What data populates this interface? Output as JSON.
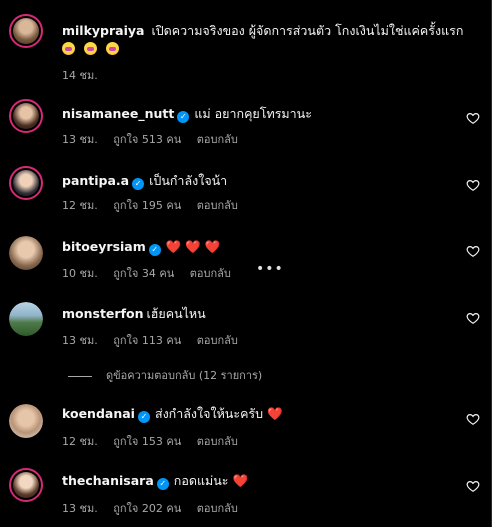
{
  "colors": {
    "background": "#000000",
    "text": "#f5f5f5",
    "meta": "#a8a8a8",
    "verified": "#0095f6",
    "heart_emoji": "#ff3040",
    "story_ring": "#d62976"
  },
  "post": {
    "username": "milkypraiya",
    "text": "เปิดความจริงของ ผู้จัดการส่วนตัว โกงเงินไม่ใช่แค่ครั้งแรก",
    "emojis": [
      "crying-face-emoji",
      "crying-face-emoji",
      "crying-face-emoji"
    ],
    "time": "14 ชม."
  },
  "comments": [
    {
      "username": "nisamanee_nutt",
      "verified": true,
      "text": "แม่ อยากคุยโทรมานะ",
      "time": "13 ชม.",
      "likes": "ถูกใจ 513 คน",
      "reply": "ตอบกลับ"
    },
    {
      "username": "pantipa.a",
      "verified": true,
      "text": "เป็นกำลังใจน้า",
      "time": "12 ชม.",
      "likes": "ถูกใจ 195 คน",
      "reply": "ตอบกลับ"
    },
    {
      "username": "bitoeyrsiam",
      "verified": true,
      "text": "❤️ ❤️ ❤️",
      "time": "10 ชม.",
      "likes": "ถูกใจ 34 คน",
      "reply": "ตอบกลับ",
      "more": "•••"
    },
    {
      "username": "monsterfon",
      "verified": false,
      "text": "เฮ้ยคนไหน",
      "time": "13 ชม.",
      "likes": "ถูกใจ 113 คน",
      "reply": "ตอบกลับ"
    },
    {
      "username": "koendanai",
      "verified": true,
      "text": "ส่งกำลังใจให้นะครับ ❤️",
      "time": "12 ชม.",
      "likes": "ถูกใจ 153 คน",
      "reply": "ตอบกลับ"
    },
    {
      "username": "thechanisara",
      "verified": true,
      "text": "กอดแม่นะ ❤️",
      "time": "13 ชม.",
      "likes": "ถูกใจ 202 คน",
      "reply": "ตอบกลับ"
    }
  ],
  "view_replies": "ดูข้อความตอบกลับ (12 รายการ)"
}
